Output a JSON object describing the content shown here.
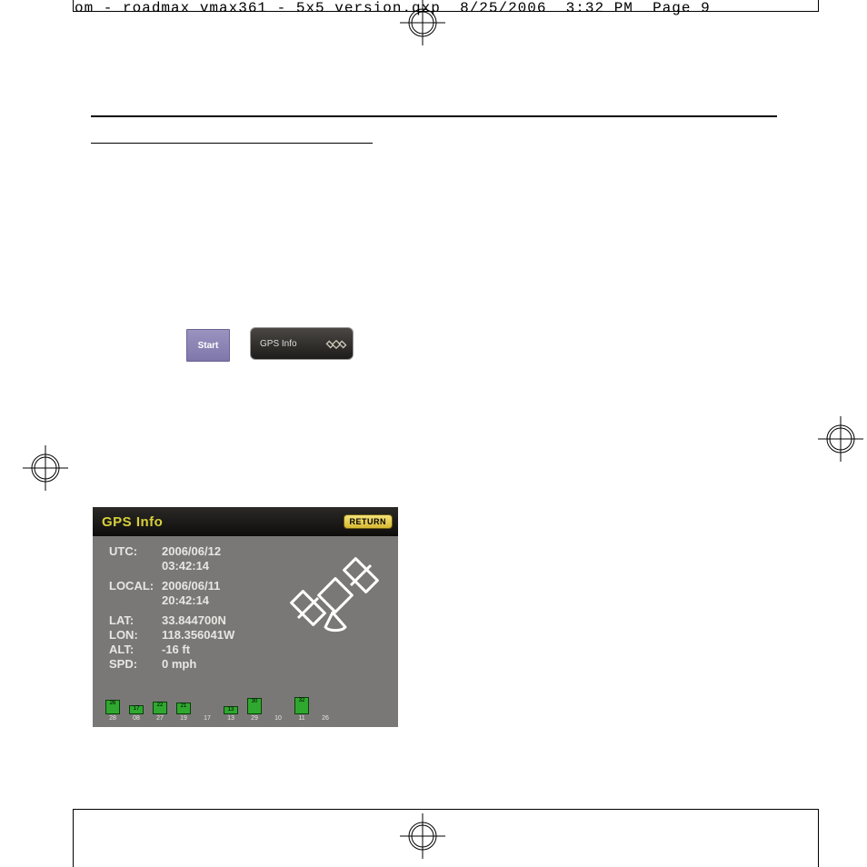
{
  "header_line": "om - roadmax vmax361 - 5x5 version.qxp  8/25/2006  3:32 PM  Page 9",
  "buttons": {
    "start_label": "Start",
    "gpsinfo_label": "GPS Info"
  },
  "gps_screen": {
    "title": "GPS Info",
    "return_label": "RETURN",
    "fields": {
      "utc_label": "UTC:",
      "utc_date": "2006/06/12",
      "utc_time": "03:42:14",
      "local_label": "LOCAL:",
      "local_date": "2006/06/11",
      "local_time": "20:42:14",
      "lat_label": "LAT:",
      "lat_val": "33.844700N",
      "lon_label": "LON:",
      "lon_val": "118.356041W",
      "alt_label": "ALT:",
      "alt_val": "-16 ft",
      "spd_label": "SPD:",
      "spd_val": "0 mph"
    },
    "sat_bars": [
      {
        "id": "28",
        "sig": "26",
        "h": 16
      },
      {
        "id": "08",
        "sig": "17",
        "h": 10
      },
      {
        "id": "27",
        "sig": "22",
        "h": 14
      },
      {
        "id": "19",
        "sig": "21",
        "h": 13
      },
      {
        "id": "17",
        "sig": "",
        "h": 0
      },
      {
        "id": "13",
        "sig": "13",
        "h": 9
      },
      {
        "id": "29",
        "sig": "30",
        "h": 18
      },
      {
        "id": "10",
        "sig": "",
        "h": 0
      },
      {
        "id": "11",
        "sig": "32",
        "h": 19
      },
      {
        "id": "26",
        "sig": "",
        "h": 0
      }
    ]
  }
}
